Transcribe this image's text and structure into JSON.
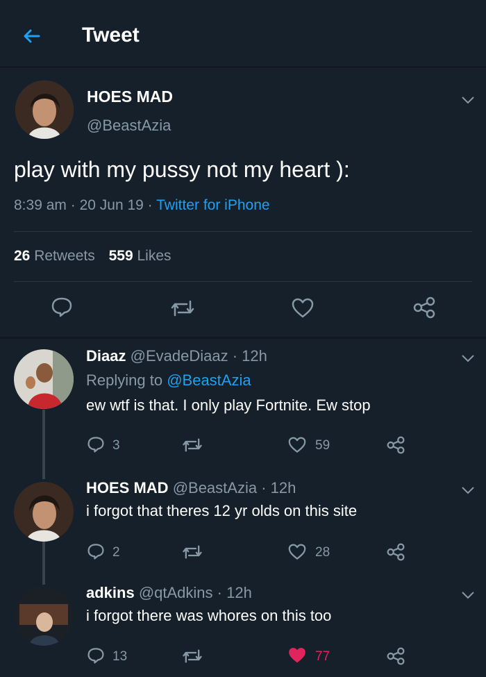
{
  "header": {
    "title": "Tweet"
  },
  "tweet": {
    "display_name": "HOES MAD",
    "handle": "@BeastAzia",
    "text": "play with my pussy not my heart ):",
    "time": "8:39 am",
    "sep1": "·",
    "date": "20 Jun 19",
    "sep2": "·",
    "source": "Twitter for iPhone",
    "retweets_count": "26",
    "retweets_label": "Retweets",
    "likes_count": "559",
    "likes_label": "Likes"
  },
  "replies": [
    {
      "display_name": "Diaaz",
      "handle": "@EvadeDiaaz",
      "time": "· 12h",
      "replying_prefix": "Replying to",
      "replying_handle": "@BeastAzia",
      "text": "ew wtf is that. I only play Fortnite.  Ew stop",
      "reply_count": "3",
      "retweet_count": "",
      "like_count": "59"
    },
    {
      "display_name": "HOES MAD",
      "handle": "@BeastAzia",
      "time": "· 12h",
      "text": "i forgot that theres 12 yr olds on this site",
      "reply_count": "2",
      "retweet_count": "",
      "like_count": "28"
    },
    {
      "display_name": "adkins",
      "handle": "@qtAdkins",
      "time": "· 12h",
      "text": "i forgot there was whores on this too",
      "reply_count": "13",
      "retweet_count": "",
      "like_count": "77",
      "liked": true
    }
  ],
  "icons": {
    "back": "arrow-left-icon",
    "reply": "speech-bubble-icon",
    "retweet": "retweet-icon",
    "like": "heart-icon",
    "share": "share-icon",
    "menu": "chevron-down-icon"
  },
  "colors": {
    "background": "#15202b",
    "accent": "#1da1f2",
    "muted": "#8899a6",
    "like_active": "#e0245e"
  }
}
